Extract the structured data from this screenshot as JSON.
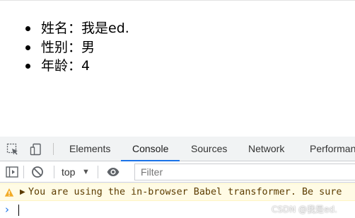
{
  "page": {
    "items": [
      "姓名：我是ed.",
      "性别：男",
      "年龄：4"
    ]
  },
  "devtools": {
    "tabs": [
      {
        "label": "Elements",
        "active": false
      },
      {
        "label": "Console",
        "active": true
      },
      {
        "label": "Sources",
        "active": false
      },
      {
        "label": "Network",
        "active": false
      },
      {
        "label": "Performan",
        "active": false
      }
    ],
    "toolbar": {
      "context": "top",
      "filter_placeholder": "Filter"
    },
    "messages": [
      {
        "level": "warning",
        "text": "You are using the in-browser Babel transformer. Be sure"
      }
    ],
    "prompt_symbol": "›"
  },
  "watermark": "CSDN @我是ed.",
  "colors": {
    "accent": "#1a73e8",
    "warning_bg": "#fffbe5",
    "warning_text": "#5c3c00",
    "warning_icon": "#f2ab26"
  },
  "icons": [
    "inspect-element-icon",
    "device-toolbar-icon",
    "show-sidebar-icon",
    "clear-console-icon",
    "dropdown-arrow-icon",
    "live-expression-eye-icon",
    "warning-icon",
    "expand-arrow-icon",
    "prompt-chevron-icon"
  ]
}
